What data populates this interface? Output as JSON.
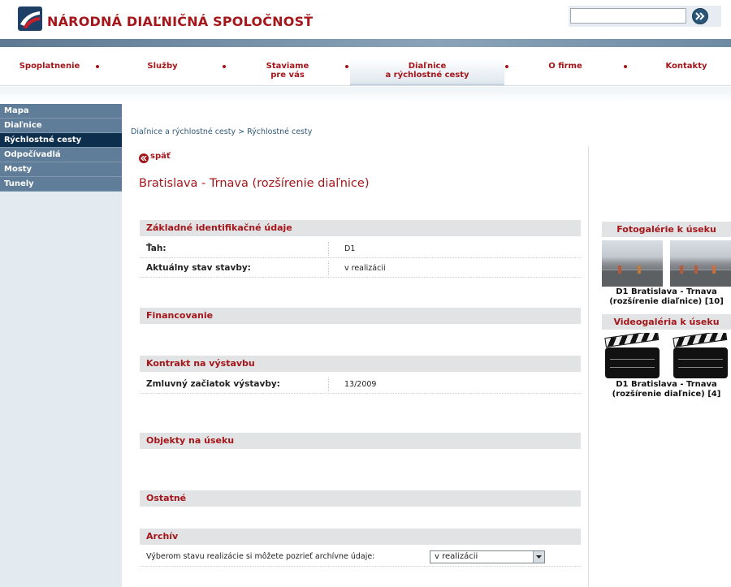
{
  "header": {
    "logo_text": "NÁRODNÁ DIAĽNIČNÁ SPOLOČNOSŤ",
    "search": {
      "value": "",
      "placeholder": ""
    },
    "brand_color": "#a4161a"
  },
  "top_nav": {
    "items": [
      {
        "label": "Spoplatnenie"
      },
      {
        "label": "Služby"
      },
      {
        "label_line1": "Staviame",
        "label_line2": "pre vás"
      },
      {
        "label_line1": "Diaľnice",
        "label_line2": "a rýchlostné cesty",
        "active": true
      },
      {
        "label": "O firme"
      },
      {
        "label": "Kontakty"
      }
    ]
  },
  "sidebar": {
    "items": [
      {
        "label": "Mapa"
      },
      {
        "label": "Diaľnice"
      },
      {
        "label": "Rýchlostné cesty",
        "active": true
      },
      {
        "label": "Odpočívadlá"
      },
      {
        "label": "Mosty"
      },
      {
        "label": "Tunely"
      }
    ]
  },
  "main": {
    "breadcrumb": "Diaľnice a rýchlostné cesty > Rýchlostné cesty",
    "back_label": "späť",
    "title": "Bratislava - Trnava (rozšírenie diaľnice)",
    "sections": {
      "basic": {
        "heading": "Základné identifikačné údaje",
        "rows": [
          {
            "key": "Ťah:",
            "value": "D1"
          },
          {
            "key": "Aktuálny stav stavby:",
            "value": "v realizácii"
          }
        ]
      },
      "financing": {
        "heading": "Financovanie"
      },
      "contract": {
        "heading": "Kontrakt na výstavbu",
        "rows": [
          {
            "key": "Zmluvný začiatok výstavby:",
            "value": "13/2009"
          }
        ]
      },
      "objects": {
        "heading": "Objekty na úseku"
      },
      "other": {
        "heading": "Ostatné"
      },
      "archive": {
        "heading": "Archív",
        "label": "Výberom stavu realizácie si môžete pozrieť archívne údaje:",
        "select_value": "v realizácii"
      }
    }
  },
  "right": {
    "photo_gallery": {
      "heading": "Fotogalérie k úseku",
      "caption_line1": "D1 Bratislava - Trnava",
      "caption_line2": "(rozšírenie diaľnice) [10]"
    },
    "video_gallery": {
      "heading": "Videogaléria k úseku",
      "caption_line1": "D1 Bratislava - Trnava",
      "caption_line2": "(rozšírenie diaľnice) [4]"
    }
  }
}
